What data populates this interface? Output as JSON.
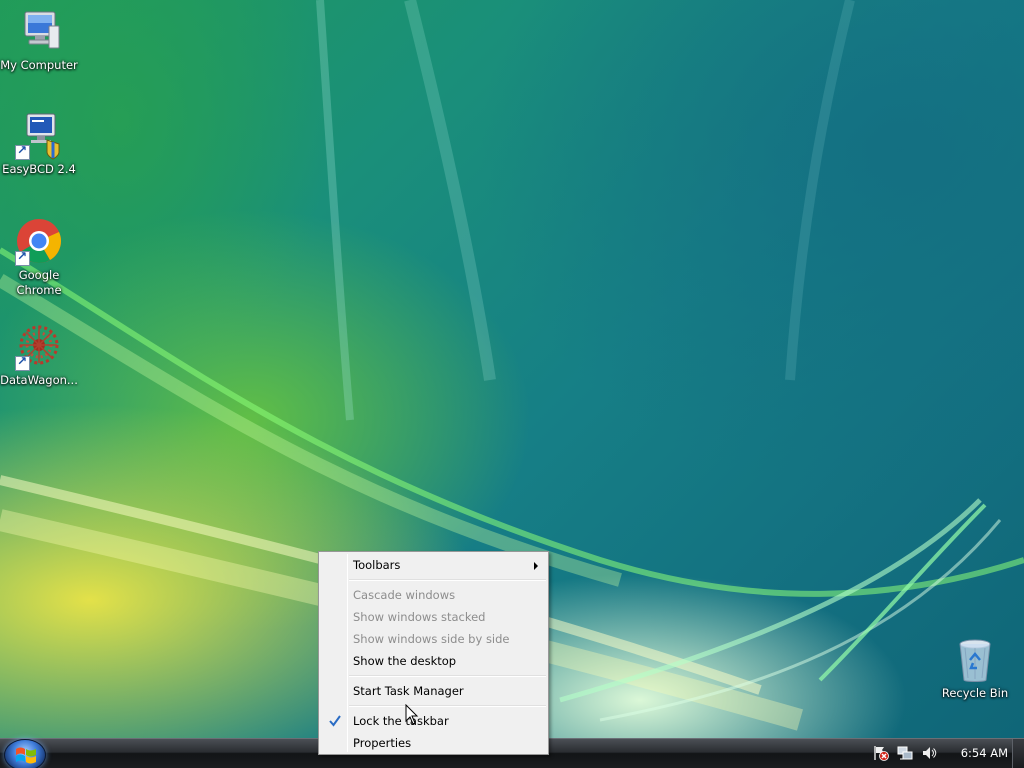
{
  "desktop": {
    "icons": [
      {
        "label": "My Computer",
        "icon": "computer-icon"
      },
      {
        "label": "EasyBCD 2.4",
        "icon": "easybcd-icon"
      },
      {
        "label": "Google Chrome",
        "icon": "chrome-icon"
      },
      {
        "label": "DataWagon...",
        "icon": "datawagon-icon"
      },
      {
        "label": "Recycle Bin",
        "icon": "recycle-bin-icon"
      }
    ]
  },
  "context_menu": {
    "items": {
      "toolbars": "Toolbars",
      "cascade": "Cascade windows",
      "stacked": "Show windows stacked",
      "side_by_side": "Show windows side by side",
      "show_desktop": "Show the desktop",
      "task_manager": "Start Task Manager",
      "lock_taskbar": "Lock the taskbar",
      "properties": "Properties"
    },
    "lock_taskbar_checked": true
  },
  "taskbar": {
    "clock": "6:54 AM",
    "tray_icons": [
      "action-center-flag-icon",
      "network-icon",
      "volume-icon"
    ]
  },
  "colors": {
    "menu_bg": "#f0f0f0",
    "disabled_text": "#8d8d8d",
    "check": "#2a6cc4"
  }
}
